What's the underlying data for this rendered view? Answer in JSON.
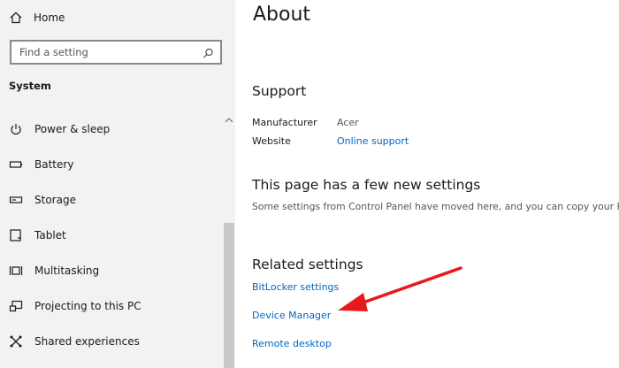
{
  "sidebar": {
    "home_label": "Home",
    "search_placeholder": "Find a setting",
    "section_label": "System",
    "items": [
      {
        "label": "Power & sleep",
        "icon": "power-icon"
      },
      {
        "label": "Battery",
        "icon": "battery-icon"
      },
      {
        "label": "Storage",
        "icon": "storage-icon"
      },
      {
        "label": "Tablet",
        "icon": "tablet-icon"
      },
      {
        "label": "Multitasking",
        "icon": "multitasking-icon"
      },
      {
        "label": "Projecting to this PC",
        "icon": "projecting-icon"
      },
      {
        "label": "Shared experiences",
        "icon": "shared-experiences-icon"
      }
    ]
  },
  "main": {
    "title": "About",
    "support": {
      "heading": "Support",
      "manufacturer_label": "Manufacturer",
      "manufacturer_value": "Acer",
      "website_label": "Website",
      "website_link": "Online support"
    },
    "new_settings": {
      "heading": "This page has a few new settings",
      "description": "Some settings from Control Panel have moved here, and you can copy your PC in"
    },
    "related": {
      "heading": "Related settings",
      "links": [
        "BitLocker settings",
        "Device Manager",
        "Remote desktop"
      ]
    }
  },
  "annotation": {
    "color": "#e8191b"
  }
}
